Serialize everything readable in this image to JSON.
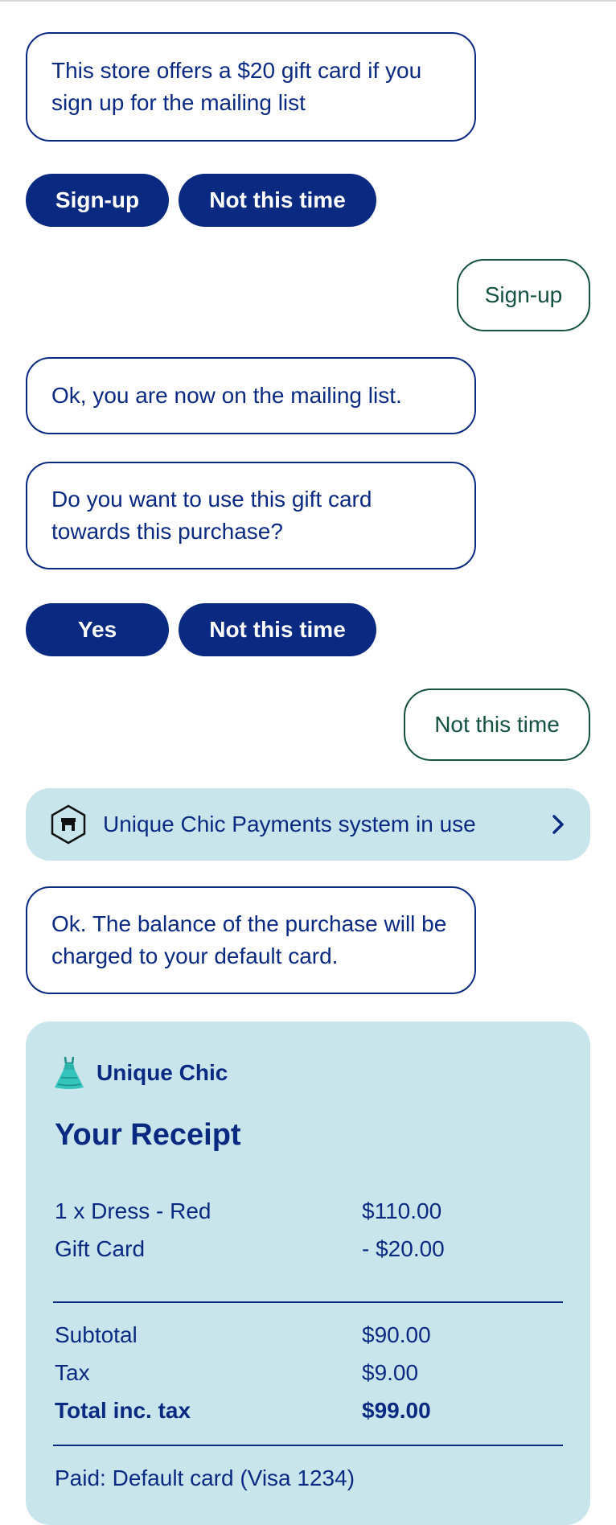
{
  "messages": {
    "bot1": "This store offers a $20 gift card if you sign up for the mailing list",
    "options1": {
      "yes": "Sign-up",
      "no": "Not this time"
    },
    "user1": "Sign-up",
    "bot2": "Ok, you are now on the mailing list.",
    "bot3": "Do you want to use this gift card towards this purchase?",
    "options2": {
      "yes": "Yes",
      "no": "Not this time"
    },
    "user2": "Not this time",
    "system": {
      "text": "Unique Chic Payments system in use",
      "icon": "store-icon"
    },
    "bot4": "Ok. The balance of the purchase will be charged to your default card."
  },
  "receipt": {
    "store_icon": "dress-icon",
    "store_name": "Unique Chic",
    "title": "Your Receipt",
    "items": [
      {
        "label": "1 x Dress - Red",
        "value": "$110.00"
      },
      {
        "label": "Gift Card",
        "value": "- $20.00"
      }
    ],
    "totals": [
      {
        "label": "Subtotal",
        "value": "$90.00"
      },
      {
        "label": "Tax",
        "value": "$9.00"
      },
      {
        "label": "Total inc. tax",
        "value": "$99.00"
      }
    ],
    "paid": "Paid: Default card (Visa 1234)"
  },
  "colors": {
    "primary": "#0a2a82",
    "user": "#14513f",
    "panel": "#c9e5ec"
  }
}
